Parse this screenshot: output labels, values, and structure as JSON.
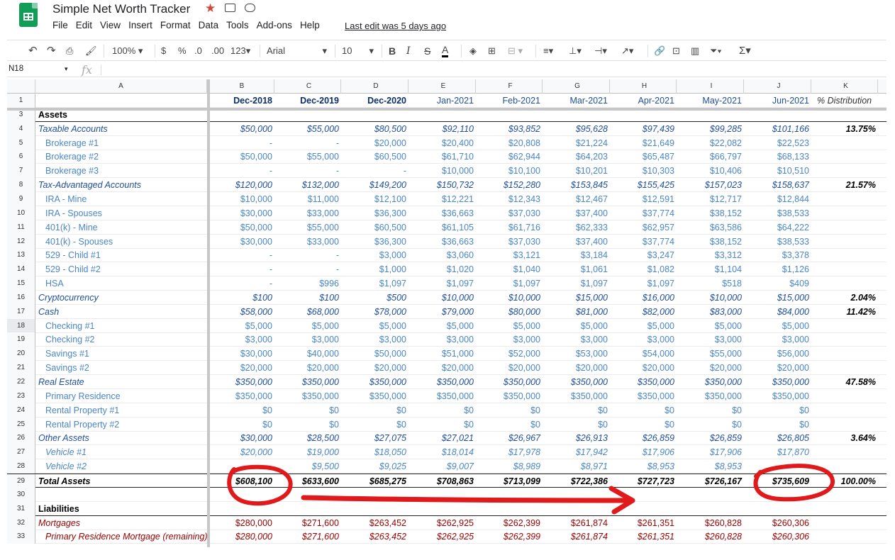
{
  "doc": {
    "title": "Simple Net Worth Tracker",
    "last_edit": "Last edit was 5 days ago"
  },
  "menu": [
    "File",
    "Edit",
    "View",
    "Insert",
    "Format",
    "Data",
    "Tools",
    "Add-ons",
    "Help"
  ],
  "toolbar": {
    "zoom": "100%",
    "currency": "$",
    "percent": "%",
    "dec_less": ".0",
    "dec_more": ".00",
    "more_formats": "123",
    "font": "Arial",
    "size": "10",
    "bold": "B",
    "italic": "I",
    "strike": "S",
    "text_color": "A"
  },
  "formula_bar": {
    "cell_ref": "N18",
    "fx": "fx"
  },
  "colors": {
    "dark_blue": "#1f4e9c",
    "light_blue": "#4a86c8",
    "red": "#990000",
    "annot": "#e0191b",
    "sheets_green": "#0f9d58"
  },
  "columns": [
    "A",
    "B",
    "C",
    "D",
    "E",
    "F",
    "G",
    "H",
    "I",
    "J",
    "K"
  ],
  "rows": [
    {
      "n": "1",
      "style": "header",
      "cells": [
        "",
        "Dec-2018",
        "Dec-2019",
        "Dec-2020",
        "Jan-2021",
        "Feb-2021",
        "Mar-2021",
        "Apr-2021",
        "May-2021",
        "Jun-2021",
        "% Distribution"
      ]
    },
    {
      "n": "3",
      "style": "section",
      "cells": [
        "Assets",
        "",
        "",
        "",
        "",
        "",
        "",
        "",
        "",
        "",
        ""
      ]
    },
    {
      "n": "4",
      "style": "group",
      "cells": [
        "Taxable Accounts",
        "$50,000",
        "$55,000",
        "$80,500",
        "$92,110",
        "$93,852",
        "$95,628",
        "$97,439",
        "$99,285",
        "$101,166",
        "13.75%"
      ]
    },
    {
      "n": "5",
      "style": "item",
      "cells": [
        "Brokerage #1",
        "-",
        "-",
        "$20,000",
        "$20,400",
        "$20,808",
        "$21,224",
        "$21,649",
        "$22,082",
        "$22,523",
        ""
      ]
    },
    {
      "n": "6",
      "style": "item",
      "cells": [
        "Brokerage #2",
        "$50,000",
        "$55,000",
        "$60,500",
        "$61,710",
        "$62,944",
        "$64,203",
        "$65,487",
        "$66,797",
        "$68,133",
        ""
      ]
    },
    {
      "n": "7",
      "style": "item",
      "cells": [
        "Brokerage #3",
        "-",
        "-",
        "-",
        "$10,000",
        "$10,100",
        "$10,201",
        "$10,303",
        "$10,406",
        "$10,510",
        ""
      ]
    },
    {
      "n": "8",
      "style": "group",
      "cells": [
        "Tax-Advantaged Accounts",
        "$120,000",
        "$132,000",
        "$149,200",
        "$150,732",
        "$152,280",
        "$153,845",
        "$155,425",
        "$157,023",
        "$158,637",
        "21.57%"
      ]
    },
    {
      "n": "9",
      "style": "item",
      "cells": [
        "IRA - Mine",
        "$10,000",
        "$11,000",
        "$12,100",
        "$12,221",
        "$12,343",
        "$12,467",
        "$12,591",
        "$12,717",
        "$12,844",
        ""
      ]
    },
    {
      "n": "10",
      "style": "item",
      "cells": [
        "IRA - Spouses",
        "$30,000",
        "$33,000",
        "$36,300",
        "$36,663",
        "$37,030",
        "$37,400",
        "$37,774",
        "$38,152",
        "$38,533",
        ""
      ]
    },
    {
      "n": "11",
      "style": "item",
      "cells": [
        "401(k) - Mine",
        "$50,000",
        "$55,000",
        "$60,500",
        "$61,105",
        "$61,716",
        "$62,333",
        "$62,957",
        "$63,586",
        "$64,222",
        ""
      ]
    },
    {
      "n": "12",
      "style": "item",
      "cells": [
        "401(k) - Spouses",
        "$30,000",
        "$33,000",
        "$36,300",
        "$36,663",
        "$37,030",
        "$37,400",
        "$37,774",
        "$38,152",
        "$38,533",
        ""
      ]
    },
    {
      "n": "13",
      "style": "item",
      "cells": [
        "529 - Child #1",
        "-",
        "-",
        "$3,000",
        "$3,060",
        "$3,121",
        "$3,184",
        "$3,247",
        "$3,312",
        "$3,378",
        ""
      ]
    },
    {
      "n": "14",
      "style": "item",
      "cells": [
        "529 - Child #2",
        "-",
        "-",
        "$1,000",
        "$1,020",
        "$1,040",
        "$1,061",
        "$1,082",
        "$1,104",
        "$1,126",
        ""
      ]
    },
    {
      "n": "15",
      "style": "item",
      "cells": [
        "HSA",
        "-",
        "$996",
        "$1,097",
        "$1,097",
        "$1,097",
        "$1,097",
        "$1,097",
        "$518",
        "$409",
        ""
      ]
    },
    {
      "n": "16",
      "style": "group",
      "cells": [
        "Cryptocurrency",
        "$100",
        "$100",
        "$500",
        "$10,000",
        "$10,000",
        "$15,000",
        "$16,000",
        "$10,000",
        "$15,000",
        "2.04%"
      ]
    },
    {
      "n": "17",
      "style": "group",
      "cells": [
        "Cash",
        "$58,000",
        "$68,000",
        "$78,000",
        "$79,000",
        "$80,000",
        "$81,000",
        "$82,000",
        "$83,000",
        "$84,000",
        "11.42%"
      ]
    },
    {
      "n": "18",
      "style": "item",
      "cells": [
        "Checking #1",
        "$5,000",
        "$5,000",
        "$5,000",
        "$5,000",
        "$5,000",
        "$5,000",
        "$5,000",
        "$5,000",
        "$5,000",
        ""
      ]
    },
    {
      "n": "19",
      "style": "item",
      "cells": [
        "Checking #2",
        "$3,000",
        "$3,000",
        "$3,000",
        "$3,000",
        "$3,000",
        "$3,000",
        "$3,000",
        "$3,000",
        "$3,000",
        ""
      ]
    },
    {
      "n": "20",
      "style": "item",
      "cells": [
        "Savings #1",
        "$30,000",
        "$40,000",
        "$50,000",
        "$51,000",
        "$52,000",
        "$53,000",
        "$54,000",
        "$55,000",
        "$56,000",
        ""
      ]
    },
    {
      "n": "21",
      "style": "item",
      "cells": [
        "Savings #2",
        "$20,000",
        "$20,000",
        "$20,000",
        "$20,000",
        "$20,000",
        "$20,000",
        "$20,000",
        "$20,000",
        "$20,000",
        ""
      ]
    },
    {
      "n": "22",
      "style": "group",
      "cells": [
        "Real Estate",
        "$350,000",
        "$350,000",
        "$350,000",
        "$350,000",
        "$350,000",
        "$350,000",
        "$350,000",
        "$350,000",
        "$350,000",
        "47.58%"
      ]
    },
    {
      "n": "23",
      "style": "item",
      "cells": [
        "Primary Residence",
        "$350,000",
        "$350,000",
        "$350,000",
        "$350,000",
        "$350,000",
        "$350,000",
        "$350,000",
        "$350,000",
        "$350,000",
        ""
      ]
    },
    {
      "n": "24",
      "style": "item",
      "cells": [
        "Rental Property #1",
        "$0",
        "$0",
        "$0",
        "$0",
        "$0",
        "$0",
        "$0",
        "$0",
        "$0",
        ""
      ]
    },
    {
      "n": "25",
      "style": "item",
      "cells": [
        "Rental Property #2",
        "$0",
        "$0",
        "$0",
        "$0",
        "$0",
        "$0",
        "$0",
        "$0",
        "$0",
        ""
      ]
    },
    {
      "n": "26",
      "style": "group",
      "cells": [
        "Other Assets",
        "$30,000",
        "$28,500",
        "$27,075",
        "$27,021",
        "$26,967",
        "$26,913",
        "$26,859",
        "$26,859",
        "$26,805",
        "3.64%"
      ]
    },
    {
      "n": "27",
      "style": "subitem",
      "cells": [
        "Vehicle #1",
        "$20,000",
        "$19,000",
        "$18,050",
        "$18,014",
        "$17,978",
        "$17,942",
        "$17,906",
        "$17,906",
        "$17,870",
        ""
      ]
    },
    {
      "n": "28",
      "style": "subitem",
      "cells": [
        "Vehicle #2",
        "",
        "$9,500",
        "$9,025",
        "$9,007",
        "$8,989",
        "$8,971",
        "$8,953",
        "$8,953",
        "",
        ""
      ]
    },
    {
      "n": "29",
      "style": "total",
      "cells": [
        "Total Assets",
        "$608,100",
        "$633,600",
        "$685,275",
        "$708,863",
        "$713,099",
        "$722,386",
        "$727,723",
        "$726,167",
        "$735,609",
        "100.00%"
      ]
    },
    {
      "n": "30",
      "style": "blank",
      "cells": [
        "",
        "",
        "",
        "",
        "",
        "",
        "",
        "",
        "",
        "",
        ""
      ]
    },
    {
      "n": "31",
      "style": "section",
      "cells": [
        "Liabilities",
        "",
        "",
        "",
        "",
        "",
        "",
        "",
        "",
        "",
        ""
      ]
    },
    {
      "n": "32",
      "style": "liabgroup",
      "cells": [
        "Mortgages",
        "$280,000",
        "$271,600",
        "$263,452",
        "$262,925",
        "$262,399",
        "$261,874",
        "$261,351",
        "$260,828",
        "$260,306",
        ""
      ]
    },
    {
      "n": "33",
      "style": "liabitem",
      "cells": [
        "Primary Residence Mortgage (remaining)",
        "$280,000",
        "$271,600",
        "$263,452",
        "$262,925",
        "$262,399",
        "$261,874",
        "$261,351",
        "$260,828",
        "$260,306",
        ""
      ]
    }
  ]
}
